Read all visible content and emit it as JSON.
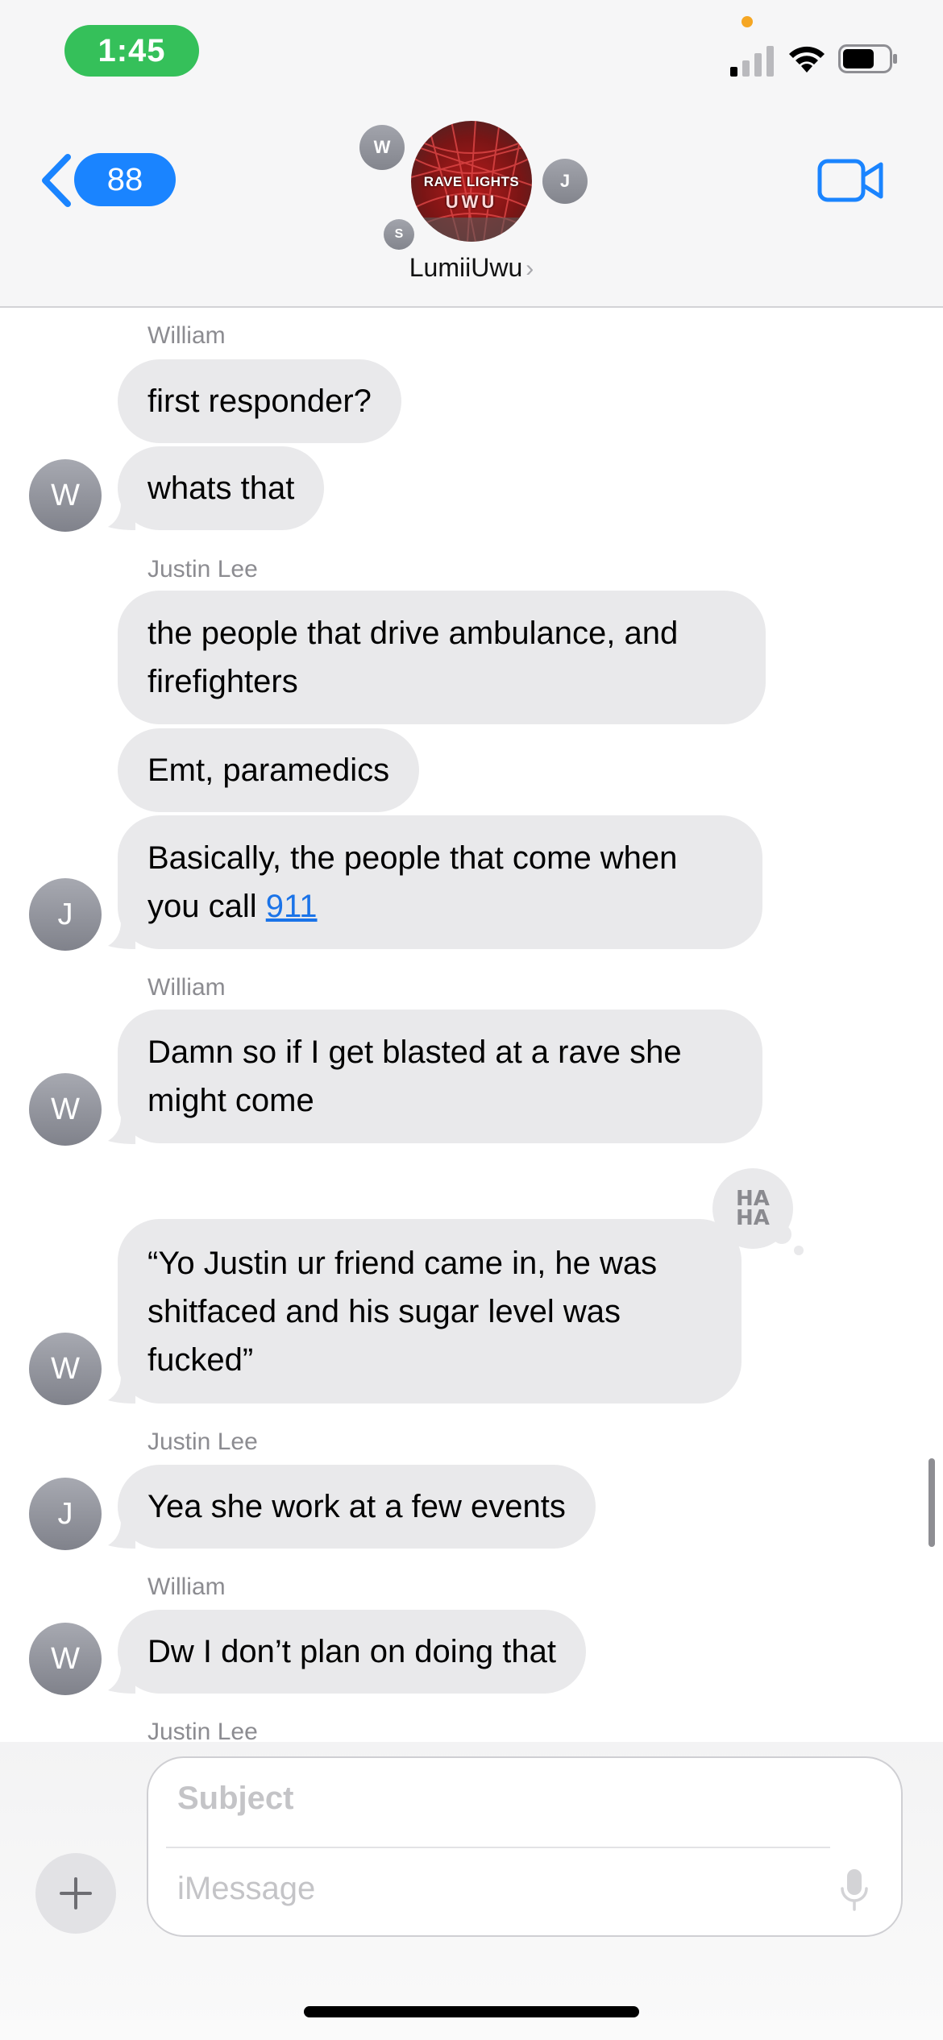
{
  "status_bar": {
    "time": "1:45"
  },
  "header": {
    "back_badge_count": "88",
    "group_name": "LumiiUwu",
    "group_avatar_line1": "RAVE LIGHTS",
    "group_avatar_line2": "UWU",
    "member_initials": [
      "W",
      "J",
      "S"
    ]
  },
  "messages": [
    {
      "sender": "William",
      "texts": [
        "first responder?",
        "whats that"
      ],
      "avatar": "W"
    },
    {
      "sender": "Justin Lee",
      "texts": [
        "the people that drive ambulance, and firefighters",
        "Emt, paramedics",
        "Basically, the people that come when you call 911"
      ],
      "link_text": "911",
      "avatar": "J"
    },
    {
      "sender": "William",
      "texts": [
        "Damn so if I get blasted at a rave she might come",
        "“Yo Justin ur friend came in, he was shitfaced and his sugar level was fucked”"
      ],
      "avatar": "W",
      "tapback": "HA HA"
    },
    {
      "sender": "Justin Lee",
      "texts": [
        "Yea she work at a few events"
      ],
      "avatar": "J"
    },
    {
      "sender": "William",
      "texts": [
        "Dw I don’t plan on doing that"
      ],
      "avatar": "W"
    },
    {
      "sender": "Justin Lee",
      "texts": []
    }
  ],
  "bubbles": {
    "b1": "first responder?",
    "b2": "whats that",
    "b3_l1": "the people that drive ambulance, and",
    "b3_l2": "firefighters",
    "b4": "Emt, paramedics",
    "b5_l1": "Basically, the people that come when",
    "b5_l2_prefix": "you call ",
    "b5_link": "911",
    "b6_l1": "Damn so if I get blasted at a rave she",
    "b6_l2": "might come",
    "b7_l1": "“Yo Justin ur friend came in, he was",
    "b7_l2": "shitfaced and his sugar level was",
    "b7_l3": "fucked”",
    "b8": "Yea she work at a few events",
    "b9": "Dw I don’t plan on doing that"
  },
  "senders": {
    "s1": "William",
    "s2": "Justin Lee",
    "s3": "William",
    "s4": "Justin Lee",
    "s5": "William",
    "s6": "Justin Lee"
  },
  "avatars": {
    "a1": "W",
    "a2": "J",
    "a3": "W",
    "a4": "W",
    "a5": "J",
    "a6": "W"
  },
  "tapback": {
    "line1": "HA",
    "line2": "HA"
  },
  "composer": {
    "subject_placeholder": "Subject",
    "message_placeholder": "iMessage"
  },
  "colors": {
    "accent": "#1a84ff",
    "bubble_gray": "#e9e9eb",
    "status_green": "#35c05a",
    "link": "#1a73e8"
  },
  "icons": [
    "back-chevron-icon",
    "facetime-video-icon",
    "plus-icon",
    "microphone-icon",
    "signal-icon",
    "wifi-icon",
    "battery-icon"
  ]
}
